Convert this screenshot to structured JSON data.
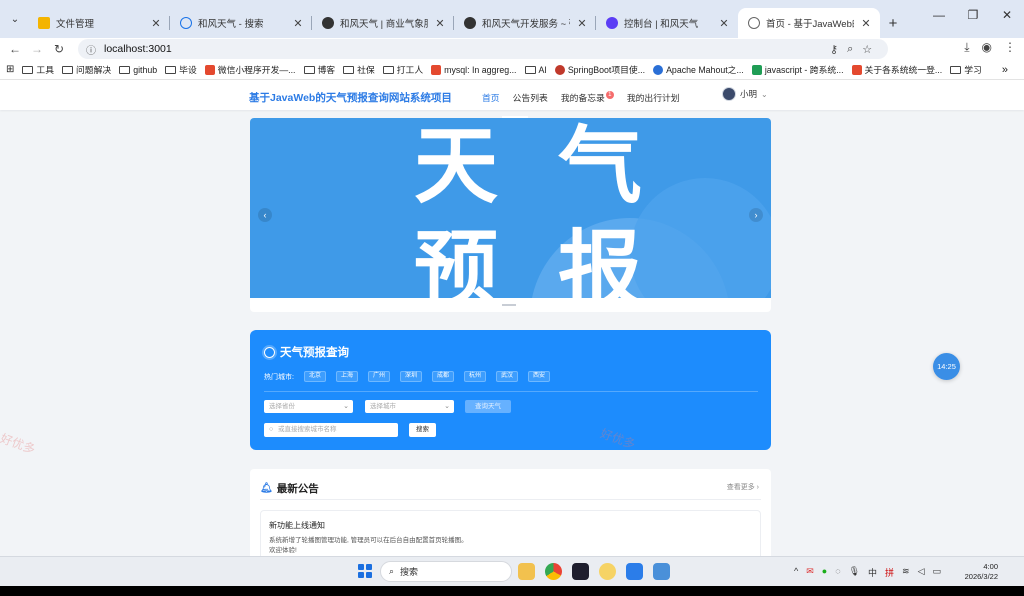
{
  "browser": {
    "tabs": [
      {
        "title": "文件管理",
        "icon": "folder-icon",
        "color": "#f4b400",
        "active": false
      },
      {
        "title": "和风天气 - 搜索",
        "icon": "search-icon",
        "color": "#1a73e8",
        "active": false
      },
      {
        "title": "和风天气 | 商业气象服务商, 天气",
        "icon": "qweather-icon",
        "color": "#333333",
        "active": false
      },
      {
        "title": "和风天气开发服务 ~ 强大, 丰富",
        "icon": "qweather-icon",
        "color": "#333333",
        "active": false
      },
      {
        "title": "控制台 | 和风天气",
        "icon": "console-icon",
        "color": "#5b3df5",
        "active": false
      },
      {
        "title": "首页 - 基于JavaWeb的天气预报",
        "icon": "globe-icon",
        "color": "#666666",
        "active": true
      }
    ],
    "new_tab": "+",
    "url": "localhost:3001",
    "bookmarks": [
      {
        "label": "",
        "kind": "apps"
      },
      {
        "label": "工具",
        "kind": "folder"
      },
      {
        "label": "问题解决",
        "kind": "folder"
      },
      {
        "label": "github",
        "kind": "folder"
      },
      {
        "label": "毕设",
        "kind": "folder"
      },
      {
        "label": "微信小程序开发—...",
        "kind": "csdn"
      },
      {
        "label": "博客",
        "kind": "folder"
      },
      {
        "label": "社保",
        "kind": "folder"
      },
      {
        "label": "打工人",
        "kind": "folder"
      },
      {
        "label": "mysql: In aggreg...",
        "kind": "csdn"
      },
      {
        "label": "AI",
        "kind": "folder"
      },
      {
        "label": "SpringBoot项目使...",
        "kind": "springboot"
      },
      {
        "label": "Apache Mahout之...",
        "kind": "mahout"
      },
      {
        "label": "javascript - 跨系统...",
        "kind": "sf"
      },
      {
        "label": "关于各系统统一登...",
        "kind": "csdn"
      },
      {
        "label": "学习",
        "kind": "folder"
      }
    ],
    "more": "»"
  },
  "site": {
    "brand": "基于JavaWeb的天气预报查询网站系统项目",
    "nav": [
      {
        "label": "首页",
        "active": true
      },
      {
        "label": "公告列表",
        "active": false
      },
      {
        "label": "我的备忘录",
        "active": false,
        "badge": "1"
      },
      {
        "label": "我的出行计划",
        "active": false
      }
    ],
    "user": {
      "name": "小明"
    },
    "banner": {
      "line1": "天气",
      "line2": "预报",
      "prev": "‹",
      "next": "›"
    },
    "query": {
      "title": "天气预报查询",
      "hot_label": "热门城市:",
      "hot_cities": [
        "北京",
        "上海",
        "广州",
        "深圳",
        "成都",
        "杭州",
        "武汉",
        "西安"
      ],
      "province_placeholder": "选择省份",
      "city_placeholder": "选择城市",
      "query_button": "查询天气",
      "search_placeholder": "或直接搜索城市名称",
      "search_button": "搜索"
    },
    "notices": {
      "title": "最新公告",
      "more": "查看更多",
      "items": [
        {
          "title": "新功能上线通知",
          "body1": "系统新增了轮播图管理功能, 管理员可以在后台自由配置首页轮播图。",
          "body2": "欢迎体验!"
        }
      ]
    },
    "timer": "14:25",
    "watermark": "好优多"
  },
  "taskbar": {
    "search_label": "搜索",
    "time": "4:00",
    "date": "2026/3/22",
    "tray_lang": "中",
    "tray_ime": "拼"
  }
}
